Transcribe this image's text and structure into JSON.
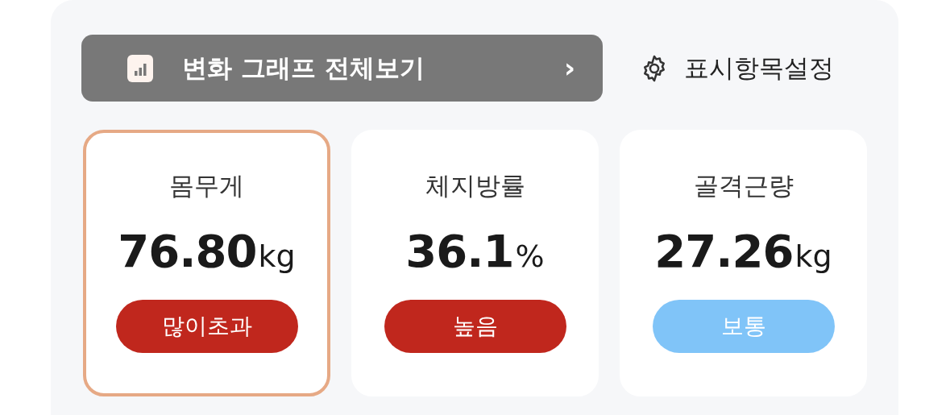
{
  "graph_button": {
    "label": "변화 그래프 전체보기",
    "chevron": "›"
  },
  "settings": {
    "label": "표시항목설정"
  },
  "cards": [
    {
      "label": "몸무게",
      "value": "76.80",
      "unit": "kg",
      "status": "많이초과",
      "color": "#c0271d",
      "selected": true
    },
    {
      "label": "체지방률",
      "value": "36.1",
      "unit": "%",
      "status": "높음",
      "color": "#c0271d",
      "selected": false
    },
    {
      "label": "골격근량",
      "value": "27.26",
      "unit": "kg",
      "status": "보통",
      "color": "#80c4f8",
      "selected": false
    }
  ]
}
